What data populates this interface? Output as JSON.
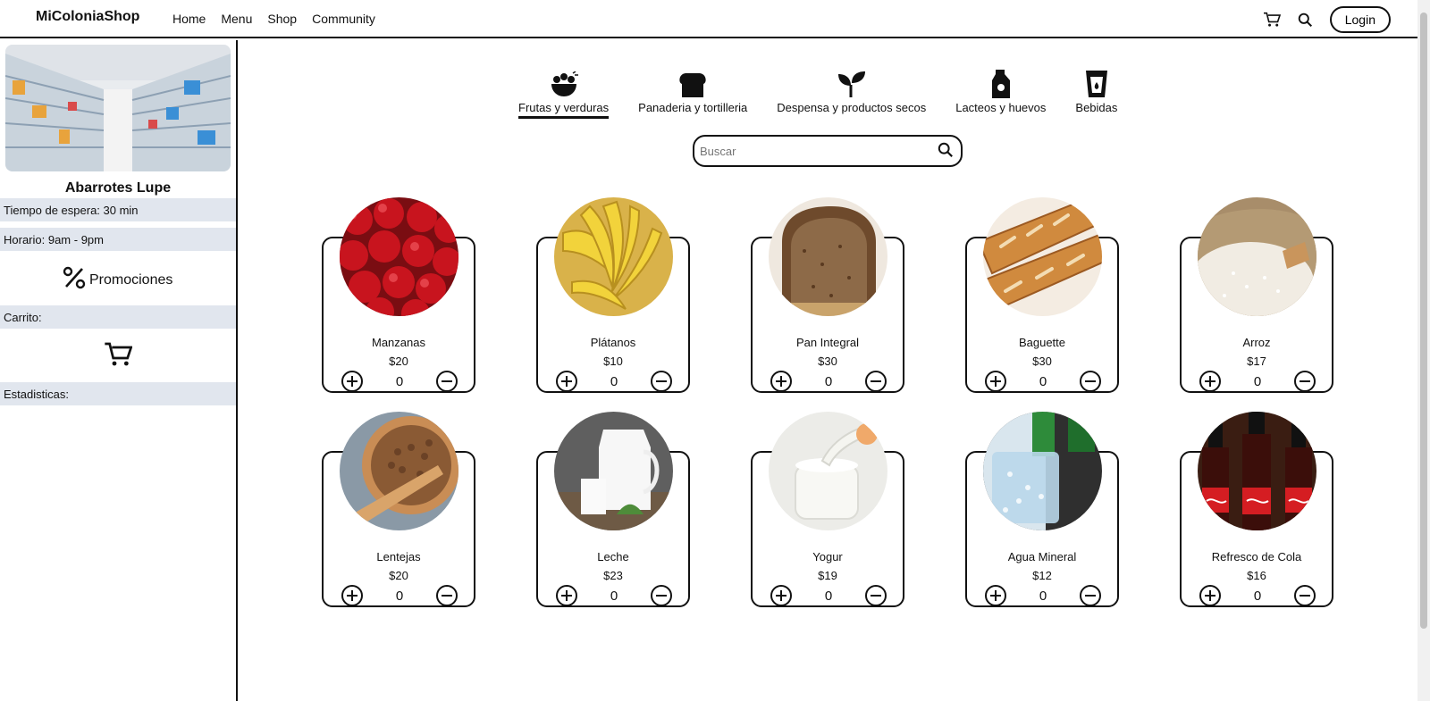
{
  "header": {
    "brand": "MiColoniaShop",
    "nav": [
      "Home",
      "Menu",
      "Shop",
      "Community"
    ],
    "login_label": "Login"
  },
  "sidebar": {
    "store_name": "Abarrotes Lupe",
    "wait_time": "Tiempo de espera: 30 min",
    "schedule": "Horario: 9am - 9pm",
    "promotions_label": "Promociones",
    "cart_label": "Carrito:",
    "stats_label": "Estadisticas:"
  },
  "categories": [
    {
      "label": "Frutas y verduras",
      "icon": "fruit-bowl-icon",
      "active": true
    },
    {
      "label": "Panaderia y tortilleria",
      "icon": "bread-icon",
      "active": false
    },
    {
      "label": "Despensa y productos secos",
      "icon": "sprout-icon",
      "active": false
    },
    {
      "label": "Lacteos y huevos",
      "icon": "milk-carton-icon",
      "active": false
    },
    {
      "label": "Bebidas",
      "icon": "drink-cup-icon",
      "active": false
    }
  ],
  "search": {
    "placeholder": "Buscar",
    "value": ""
  },
  "products": [
    {
      "name": "Manzanas",
      "price": "$20",
      "qty": "0"
    },
    {
      "name": "Plátanos",
      "price": "$10",
      "qty": "0"
    },
    {
      "name": "Pan Integral",
      "price": "$30",
      "qty": "0"
    },
    {
      "name": "Baguette",
      "price": "$30",
      "qty": "0"
    },
    {
      "name": "Arroz",
      "price": "$17",
      "qty": "0"
    },
    {
      "name": "Lentejas",
      "price": "$20",
      "qty": "0"
    },
    {
      "name": "Leche",
      "price": "$23",
      "qty": "0"
    },
    {
      "name": "Yogur",
      "price": "$19",
      "qty": "0"
    },
    {
      "name": "Agua Mineral",
      "price": "$12",
      "qty": "0"
    },
    {
      "name": "Refresco de Cola",
      "price": "$16",
      "qty": "0"
    }
  ]
}
